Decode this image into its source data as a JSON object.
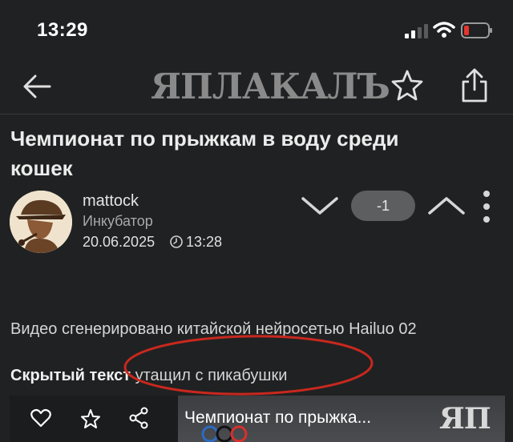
{
  "status_bar": {
    "time": "13:29",
    "battery_color": "#e5362f"
  },
  "nav": {
    "logo_text": "ЯПЛАКАЛЪ",
    "back_icon": "arrow-left-icon",
    "star_icon": "star-icon",
    "share_icon": "share-icon"
  },
  "post": {
    "title": "Чемпионат по прыжкам в воду среди кошек",
    "author": {
      "name": "mattock",
      "rank": "Инкубатор"
    },
    "date": "20.06.2025",
    "time": "13:28",
    "rating": "-1",
    "description": "Видео сгенерировано китайской нейросетью Hailuo 02",
    "hidden_label": "Скрытый текст",
    "hidden_rest": " утащил с пикабушки"
  },
  "annotation_color": "#c8281e",
  "video": {
    "title": "Чемпионат по прыжка...",
    "logo_text": "ЯП"
  }
}
